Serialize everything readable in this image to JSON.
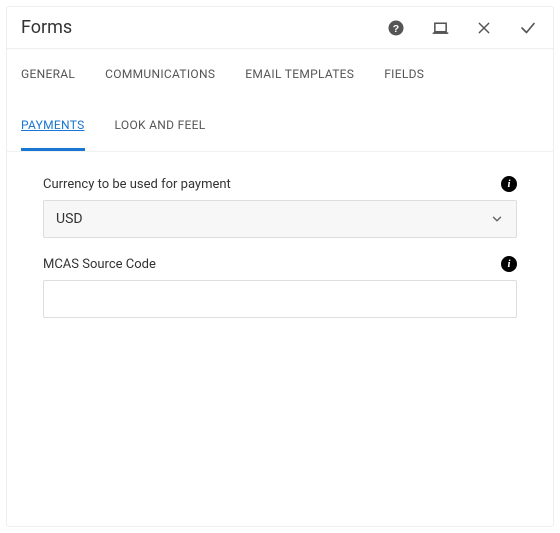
{
  "header": {
    "title": "Forms"
  },
  "icons": {
    "help": "help-icon",
    "fullscreen": "fullscreen-icon",
    "close": "close-icon",
    "confirm": "check-icon",
    "info": "i",
    "chevron": "chevron-down-icon"
  },
  "tabs": [
    {
      "id": "general",
      "label": "GENERAL",
      "active": false
    },
    {
      "id": "communications",
      "label": "COMMUNICATIONS",
      "active": false
    },
    {
      "id": "email-templates",
      "label": "EMAIL TEMPLATES",
      "active": false
    },
    {
      "id": "fields",
      "label": "FIELDS",
      "active": false
    },
    {
      "id": "payments",
      "label": "PAYMENTS",
      "active": true
    },
    {
      "id": "look-and-feel",
      "label": "LOOK AND FEEL",
      "active": false
    }
  ],
  "form": {
    "currency": {
      "label": "Currency to be used for payment",
      "value": "USD"
    },
    "mcas": {
      "label": "MCAS Source Code",
      "value": ""
    }
  }
}
